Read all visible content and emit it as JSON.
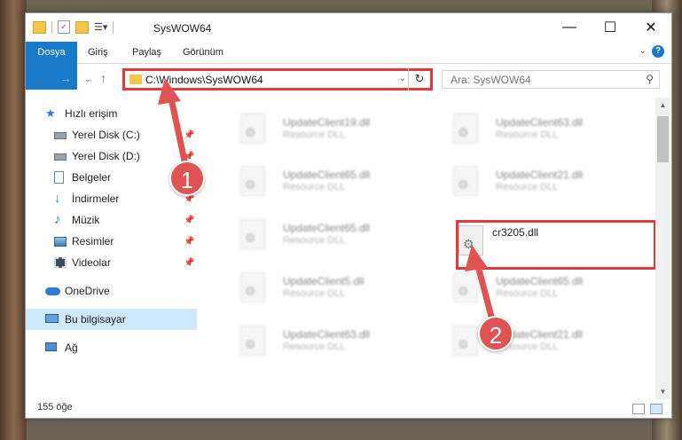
{
  "window": {
    "title": "SysWOW64",
    "controls": {
      "minimize": "—",
      "maximize": "☐",
      "close": "✕"
    }
  },
  "ribbon": {
    "tabs": [
      {
        "label": "Dosya",
        "active": true
      },
      {
        "label": "Giriş"
      },
      {
        "label": "Paylaş"
      },
      {
        "label": "Görünüm"
      }
    ]
  },
  "address": {
    "path": "C:\\Windows\\SysWOW64"
  },
  "search": {
    "placeholder": "Ara: SysWOW64"
  },
  "sidebar": {
    "items": [
      {
        "label": "Hızlı erişim",
        "icon": "star-icon",
        "pinned": false
      },
      {
        "label": "Yerel Disk (C:)",
        "icon": "drive-icon",
        "pinned": true
      },
      {
        "label": "Yerel Disk (D:)",
        "icon": "drive-icon",
        "pinned": true
      },
      {
        "label": "Belgeler",
        "icon": "documents-icon",
        "pinned": true
      },
      {
        "label": "İndirmeler",
        "icon": "download-icon",
        "pinned": true
      },
      {
        "label": "Müzik",
        "icon": "music-icon",
        "pinned": true
      },
      {
        "label": "Resimler",
        "icon": "pictures-icon",
        "pinned": true
      },
      {
        "label": "Videolar",
        "icon": "video-icon",
        "pinned": true
      },
      {
        "label": "OneDrive",
        "icon": "cloud-icon",
        "pinned": false
      },
      {
        "label": "Bu bilgisayar",
        "icon": "computer-icon",
        "pinned": false,
        "selected": true
      },
      {
        "label": "Ağ",
        "icon": "network-icon",
        "pinned": false
      }
    ]
  },
  "files": [
    {
      "name": "UpdateClient19.dll",
      "desc": "Resource DLL",
      "blurred": true
    },
    {
      "name": "UpdateClient63.dll",
      "desc": "Resource DLL",
      "blurred": true
    },
    {
      "name": "UpdateClient65.dll",
      "desc": "Resource DLL",
      "blurred": true
    },
    {
      "name": "UpdateClient21.dll",
      "desc": "Resource DLL",
      "blurred": true
    },
    {
      "name": "UpdateClient65.dll",
      "desc": "Resource DLL",
      "blurred": true
    },
    {
      "name": "cr3205.dll",
      "desc": "",
      "blurred": false,
      "highlighted": true
    },
    {
      "name": "UpdateClient5.dll",
      "desc": "Resource DLL",
      "blurred": true
    },
    {
      "name": "UpdateClient65.dll",
      "desc": "Resource DLL",
      "blurred": true
    },
    {
      "name": "UpdateClient63.dll",
      "desc": "Resource DLL",
      "blurred": true
    },
    {
      "name": "UpdateClient21.dll",
      "desc": "Resource DLL",
      "blurred": true
    }
  ],
  "status": {
    "item_count": "155 öğe"
  },
  "annotations": {
    "badge1": "1",
    "badge2": "2",
    "color": "#e05353"
  }
}
